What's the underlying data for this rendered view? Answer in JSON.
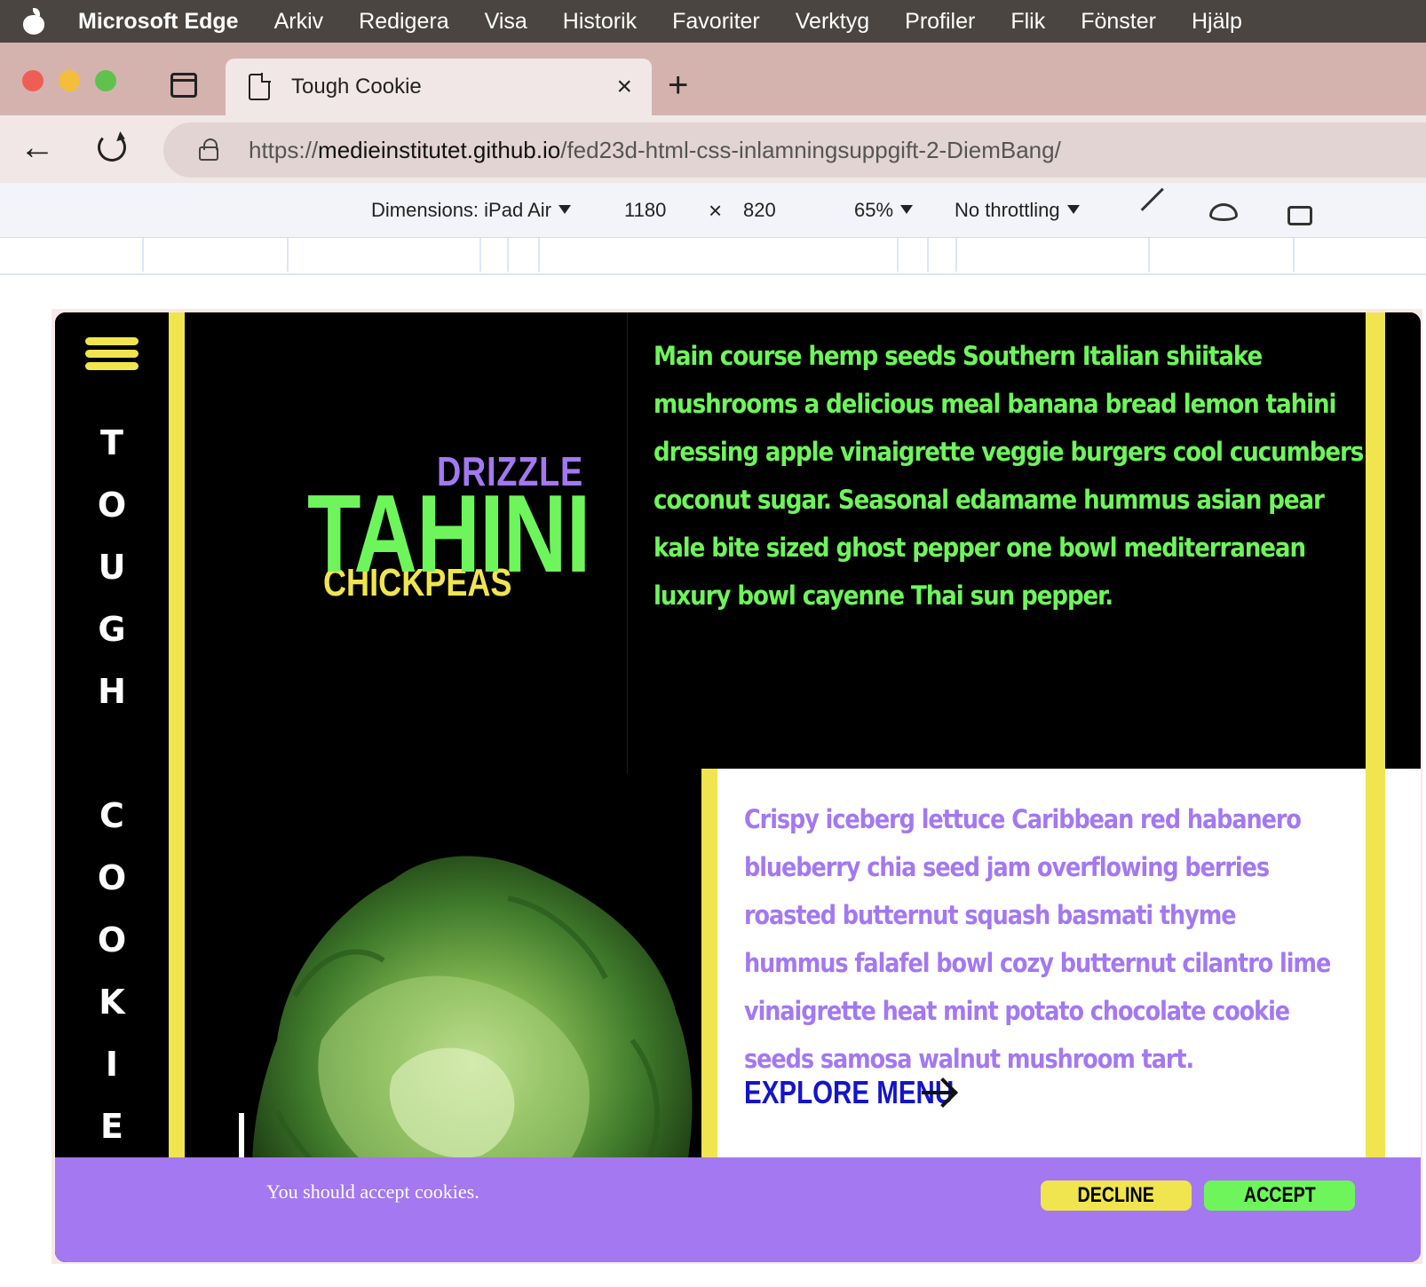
{
  "menubar": {
    "app_name": "Microsoft Edge",
    "items": [
      "Arkiv",
      "Redigera",
      "Visa",
      "Historik",
      "Favoriter",
      "Verktyg",
      "Profiler",
      "Flik",
      "Fönster",
      "Hjälp"
    ]
  },
  "tab": {
    "title": "Tough Cookie",
    "close": "×",
    "new_tab": "+"
  },
  "address": {
    "scheme": "https://",
    "host": "medieinstitutet.github.io",
    "path": "/fed23d-html-css-inlamningsuppgift-2-DiemBang/"
  },
  "devtools": {
    "dimensions_label": "Dimensions: iPad Air",
    "width": "1180",
    "times": "×",
    "height": "820",
    "zoom": "65%",
    "throttling": "No throttling"
  },
  "site": {
    "brand_letters": [
      "T",
      "O",
      "U",
      "G",
      "H",
      "",
      "C",
      "O",
      "O",
      "K",
      "I",
      "E"
    ],
    "hero_words": {
      "top": "DRIZZLE",
      "main": "TAHINI",
      "bottom": "CHICKPEAS"
    },
    "intro": "Main course hemp seeds Southern Italian shiitake mushrooms a delicious meal banana bread lemon tahini dressing apple vinaigrette veggie burgers cool cucumbers coconut sugar. Seasonal edamame hummus asian pear kale bite sized ghost pepper one bowl mediterranean luxury bowl cayenne Thai sun pepper.",
    "card_text": "Crispy iceberg lettuce Caribbean red habanero blueberry chia seed jam overflowing berries roasted butternut squash basmati thyme hummus falafel bowl cozy butternut cilantro lime vinaigrette heat mint potato chocolate cookie seeds samosa walnut mushroom tart.",
    "explore_label": "EXPLORE MENU",
    "cookie": {
      "message": "You should accept cookies.",
      "decline": "DECLINE",
      "accept": "ACCEPT"
    }
  },
  "colors": {
    "yellow": "#f0e54e",
    "green": "#6ef55b",
    "purple": "#a378f1",
    "link_blue": "#1414c8"
  }
}
